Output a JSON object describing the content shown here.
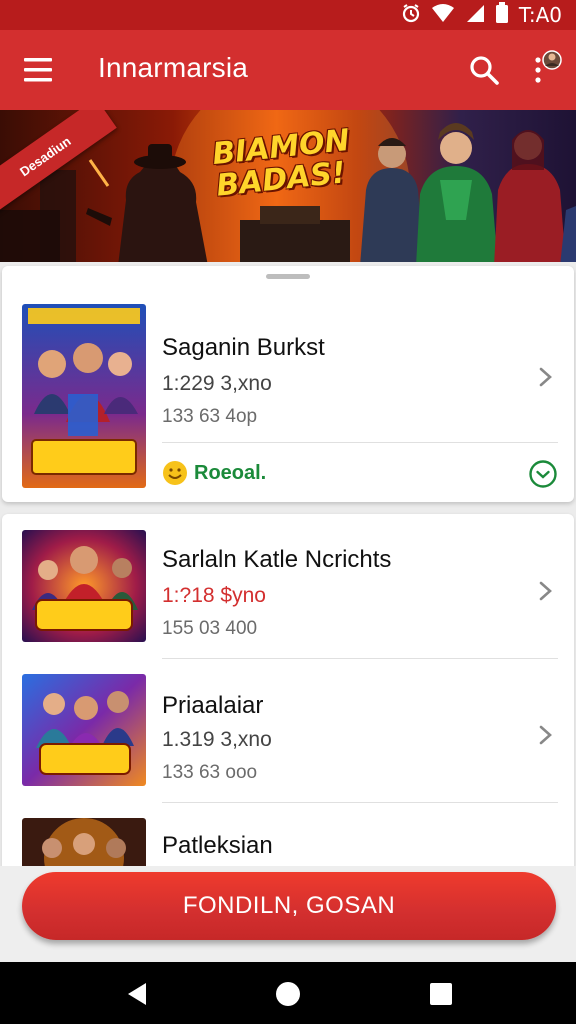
{
  "status_bar": {
    "time": "T:A0",
    "icons": [
      "alarm-icon",
      "wifi-icon",
      "signal-icon",
      "battery-icon"
    ]
  },
  "app_bar": {
    "title": "Innarmarsia",
    "icons": [
      "menu-icon",
      "search-icon",
      "more-icon"
    ]
  },
  "banner": {
    "ribbon_text": "Desadiun",
    "logo_line1": "BIAMON",
    "logo_line2": "BADAS!"
  },
  "featured": {
    "title": "Saganin Burkst",
    "price": "1:229 3,xno",
    "downloads": "133 63 4op",
    "badge_label": "Roeoal.",
    "thumb_caption": "TRBADAN"
  },
  "list": [
    {
      "title": "Sarlaln Katle Ncrichts",
      "price": "1:?18 $yno",
      "price_accent": true,
      "downloads": "155 03 400",
      "thumb_caption": "SODUAN"
    },
    {
      "title": "Priaalaiar",
      "price": "1.319 3,xno",
      "price_accent": false,
      "downloads": "133 63 ooo",
      "thumb_caption": "TARDAN"
    },
    {
      "title": "Patleksian",
      "price": "",
      "price_accent": false,
      "downloads": "",
      "thumb_caption": ""
    }
  ],
  "cta": {
    "label": "FONDILN, GOSAN"
  },
  "nav": {
    "icons": [
      "back-icon",
      "home-icon",
      "recents-icon"
    ]
  },
  "colors": {
    "primary": "#d32f2f",
    "status_bar": "#b71c1c",
    "accent_green": "#1b8a3a"
  }
}
